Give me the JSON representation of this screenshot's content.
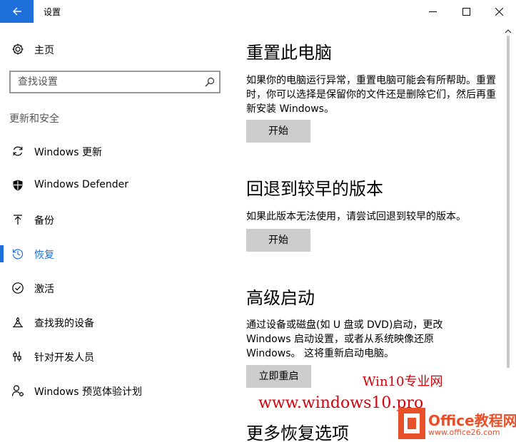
{
  "window": {
    "title": "设置",
    "accent": "#1e6fd9"
  },
  "sidebar": {
    "home_label": "主页",
    "search_placeholder": "查找设置",
    "section_heading": "更新和安全",
    "items": [
      {
        "label": "Windows 更新",
        "icon": "sync-icon"
      },
      {
        "label": "Windows Defender",
        "icon": "shield-icon"
      },
      {
        "label": "备份",
        "icon": "backup-arrow-icon"
      },
      {
        "label": "恢复",
        "icon": "history-icon",
        "active": true
      },
      {
        "label": "激活",
        "icon": "check-circle-icon"
      },
      {
        "label": "查找我的设备",
        "icon": "find-device-icon"
      },
      {
        "label": "针对开发人员",
        "icon": "developer-sliders-icon"
      },
      {
        "label": "Windows 预览体验计划",
        "icon": "insider-user-icon"
      }
    ]
  },
  "main": {
    "sections": [
      {
        "title": "重置此电脑",
        "desc": "如果你的电脑运行异常，重置电脑可能会有所帮助。重置时，你可以选择是保留你的文件还是删除它们，然后再重新安装 Windows。",
        "button": "开始"
      },
      {
        "title": "回退到较早的版本",
        "desc": "如果此版本无法使用，请尝试回退到较早的版本。",
        "button": "开始"
      },
      {
        "title": "高级启动",
        "desc": "通过设备或磁盘(如 U 盘或 DVD)启动，更改 Windows 启动设置，或者从系统映像还原 Windows。 这将重新启动电脑。",
        "button": "立即重启"
      },
      {
        "title": "更多恢复选项"
      }
    ]
  },
  "watermark": {
    "line1": "Win10专业网",
    "line2": "www.windows10.pro",
    "logo_title": "Office教程网",
    "logo_url": "www.office26.com"
  }
}
